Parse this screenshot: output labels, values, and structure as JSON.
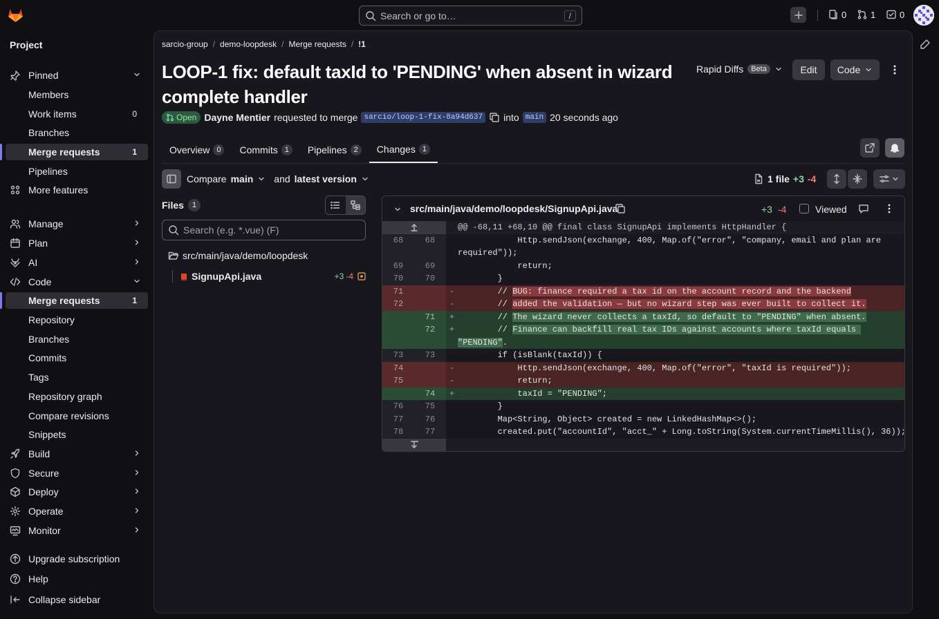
{
  "top": {
    "search_placeholder": "Search or go to…",
    "search_kbd": "/",
    "issues_count": "0",
    "mr_count": "1",
    "todo_count": "0"
  },
  "sidebar": {
    "title": "Project",
    "items": [
      {
        "label": "Pinned"
      },
      {
        "label": "Members"
      },
      {
        "label": "Work items",
        "count": "0"
      },
      {
        "label": "Branches"
      },
      {
        "label": "Merge requests",
        "count": "1"
      },
      {
        "label": "Pipelines"
      },
      {
        "label": "More features"
      },
      {
        "label": "Manage"
      },
      {
        "label": "Plan"
      },
      {
        "label": "AI"
      },
      {
        "label": "Code"
      },
      {
        "label": "Merge requests",
        "count": "1"
      },
      {
        "label": "Repository"
      },
      {
        "label": "Branches"
      },
      {
        "label": "Commits"
      },
      {
        "label": "Tags"
      },
      {
        "label": "Repository graph"
      },
      {
        "label": "Compare revisions"
      },
      {
        "label": "Snippets"
      },
      {
        "label": "Build"
      },
      {
        "label": "Secure"
      },
      {
        "label": "Deploy"
      },
      {
        "label": "Operate"
      },
      {
        "label": "Monitor"
      },
      {
        "label": "Upgrade subscription"
      },
      {
        "label": "Help"
      },
      {
        "label": "Collapse sidebar"
      }
    ]
  },
  "breadcrumb": [
    "sarcio-group",
    "demo-loopdesk",
    "Merge requests",
    "!1"
  ],
  "mr": {
    "title": "LOOP-1 fix: default taxId to 'PENDING' when absent in wizard complete handler",
    "status": "Open",
    "author": "Dayne Mentier",
    "requested": "requested to merge",
    "source_branch": "sarcio/loop-1-fix-8a94d637",
    "into": "into",
    "target_branch": "main",
    "time": "20 seconds ago"
  },
  "header_actions": {
    "rapid": "Rapid Diffs",
    "beta": "Beta",
    "edit": "Edit",
    "code": "Code"
  },
  "tabs": [
    {
      "label": "Overview",
      "count": "0"
    },
    {
      "label": "Commits",
      "count": "1"
    },
    {
      "label": "Pipelines",
      "count": "2"
    },
    {
      "label": "Changes",
      "count": "1"
    }
  ],
  "compare": {
    "label": "Compare",
    "base": "main",
    "and": "and",
    "version": "latest version"
  },
  "file_stats": {
    "files": "1 file",
    "added": "+3",
    "removed": "-4"
  },
  "files_panel": {
    "title": "Files",
    "count": "1",
    "search_placeholder": "Search (e.g. *.vue) (F)",
    "folder": "src/main/java/demo/loopdesk",
    "file": "SignupApi.java",
    "file_added": "+3",
    "file_removed": "-4"
  },
  "diff": {
    "path": "src/main/java/demo/loopdesk/SignupApi.java",
    "added": "+3",
    "removed": "-4",
    "viewed": "Viewed",
    "hunk": "@@ -68,11 +68,10 @@ final class SignupApi implements HttpHandler {",
    "lines": {
      "l68a": "            Http.sendJson(exchange, 400, Map.of(\"error\", \"company, email and plan are",
      "l68b": "required\"));",
      "l69": "            return;",
      "l70": "        }",
      "d71a": "        // ",
      "d71b": "BUG: finance required a tax id on the account record and the backend",
      "d72a": "        // ",
      "d72b": "added the validation — but no wizard step was ever built to collect it.",
      "a71a": "        // ",
      "a71b": "The wizard never collects a taxId, so default to \"PENDING\" when absent.",
      "a72a": "        // ",
      "a72b": "Finance can backfill real tax IDs against accounts where taxId equals ",
      "a72c": "\"PENDING\"",
      "a72d": ".",
      "l73": "        if (isBlank(taxId)) {",
      "d74": "            Http.sendJson(exchange, 400, Map.of(\"error\", \"taxId is required\"));",
      "d75": "            return;",
      "a74": "            taxId = \"PENDING\";",
      "l76": "        }",
      "l77": "        Map<String, Object> created = new LinkedHashMap<>();",
      "l78": "        created.put(\"accountId\", \"acct_\" + Long.toString(System.currentTimeMillis(), 36));"
    },
    "nums": {
      "o68": "68",
      "n68": "68",
      "o69": "69",
      "n69": "69",
      "o70": "70",
      "n70": "70",
      "o71": "71",
      "o72": "72",
      "n71": "71",
      "n72": "72",
      "o73": "73",
      "n73": "73",
      "o74": "74",
      "o75": "75",
      "n74": "74",
      "o76": "76",
      "n75": "75",
      "o77": "77",
      "n76": "76",
      "o78": "78",
      "n77": "77",
      "minus": "-",
      "plus": "+"
    }
  }
}
